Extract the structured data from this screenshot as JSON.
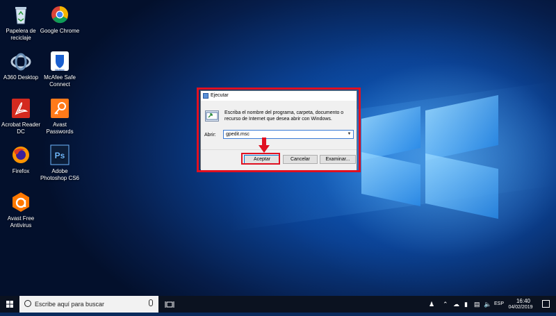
{
  "desktop": {
    "icons": [
      {
        "label": "Papelera de reciclaje",
        "icon": "recycle-bin-icon"
      },
      {
        "label": "Google Chrome",
        "icon": "chrome-icon"
      },
      {
        "label": "A360 Desktop",
        "icon": "a360-icon"
      },
      {
        "label": "McAfee Safe Connect",
        "icon": "mcafee-icon"
      },
      {
        "label": "Acrobat Reader DC",
        "icon": "acrobat-icon"
      },
      {
        "label": "Avast Passwords",
        "icon": "avast-passwords-icon"
      },
      {
        "label": "Firefox",
        "icon": "firefox-icon"
      },
      {
        "label": "Adobe Photoshop CS6",
        "icon": "photoshop-icon"
      },
      {
        "label": "Avast Free Antivirus",
        "icon": "avast-antivirus-icon"
      }
    ],
    "wallpaper_color": "#0a4fa8"
  },
  "run_dialog": {
    "title": "Ejecutar",
    "description": "Escriba el nombre del programa, carpeta, documento o recurso de Internet que desea abrir con Windows.",
    "open_label": "Abrir:",
    "open_value": "gpedit.msc",
    "ok_label": "Aceptar",
    "cancel_label": "Cancelar",
    "browse_label": "Examinar...",
    "highlight_color": "#e01020"
  },
  "taskbar": {
    "search_placeholder": "Escribe aquí para buscar",
    "language": "ESP",
    "time": "16:40",
    "date": "04/02/2019"
  }
}
